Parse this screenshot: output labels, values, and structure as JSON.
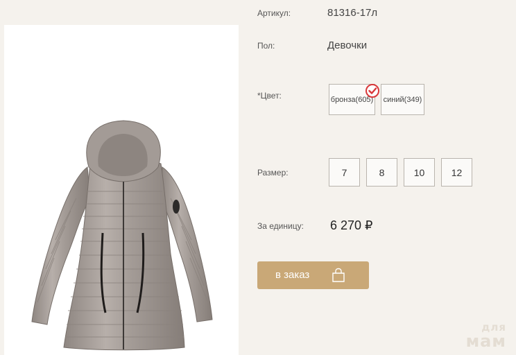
{
  "product": {
    "article_label": "Артикул:",
    "article_value": "81316-17л",
    "gender_label": "Пол:",
    "gender_value": "Девочки",
    "color_label": "*Цвет:",
    "colors": [
      {
        "label": "бронза(605)",
        "selected": true
      },
      {
        "label": "синий(349)",
        "selected": false
      }
    ],
    "size_label": "Размер:",
    "sizes": [
      "7",
      "8",
      "10",
      "12"
    ],
    "price_label": "За единицу:",
    "price": "6 270 ₽",
    "order_button": "в заказ"
  },
  "watermark": {
    "line1": "для",
    "line2": "мам"
  },
  "icons": {
    "selected_check": "check-circle-icon",
    "order_bag": "shopping-bag-icon"
  },
  "colors": {
    "accent": "#c9a877",
    "check_red": "#d9383a",
    "page_bg": "#f5f2ed"
  }
}
